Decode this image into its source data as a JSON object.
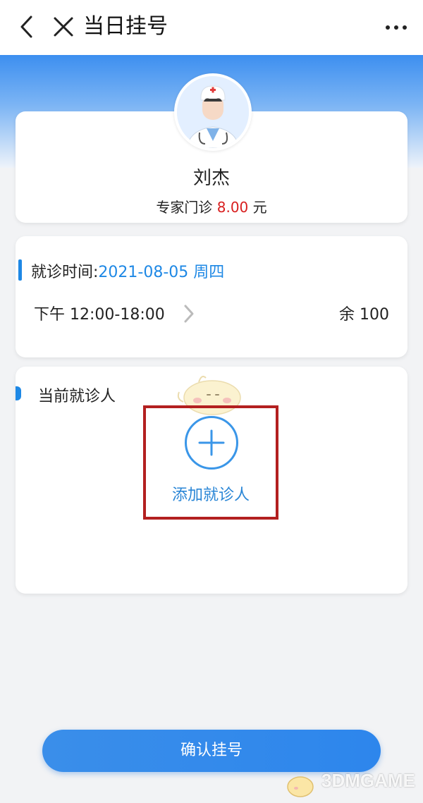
{
  "header": {
    "title": "当日挂号",
    "back_icon": "chevron-left-icon",
    "close_icon": "close-icon",
    "more_icon": "more-horizontal-icon"
  },
  "doctor": {
    "name": "刘杰",
    "fee_label": "专家门诊",
    "fee_amount": "8.00",
    "fee_unit": "元"
  },
  "visit_time": {
    "label": "就诊时间:",
    "date": "2021-08-05 周四",
    "slot": "下午 12:00-18:00",
    "remaining": "余 100"
  },
  "patient": {
    "title": "当前就诊人",
    "add_label": "添加就诊人"
  },
  "confirm_label": "确认挂号",
  "watermark": "3DMGAME",
  "colors": {
    "accent": "#1e88e5",
    "price": "#d81e1e",
    "highlight": "#b32020"
  }
}
